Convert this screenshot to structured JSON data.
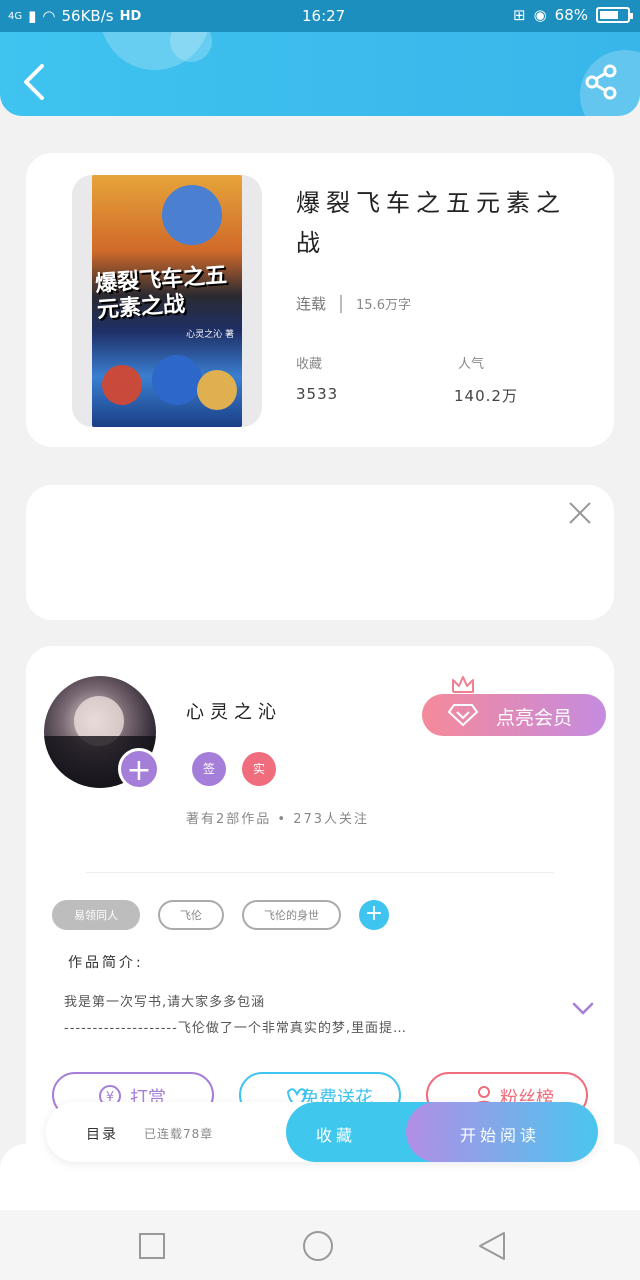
{
  "status_bar": {
    "network": "4G",
    "speed": "56KB/s",
    "hd": "HD",
    "time": "16:27",
    "battery": "68%",
    "battery_level": 0.68
  },
  "header": {
    "back_icon": "chevron-left-icon",
    "share_icon": "share-icon"
  },
  "book": {
    "title": "爆裂飞车之五元素之战",
    "cover_title": "爆裂飞车之五元素之战",
    "cover_author": "心灵之沁 著",
    "status": "连载",
    "word_count": "15.6万字",
    "stats": [
      {
        "label": "收藏",
        "value": "3533"
      },
      {
        "label": "人气",
        "value": "140.2万"
      }
    ]
  },
  "ad": {
    "close_icon": "close-icon"
  },
  "author": {
    "name": "心灵之沁",
    "badges": [
      {
        "text": "签",
        "color": "#a57ed9"
      },
      {
        "text": "实",
        "color": "#f06d7d"
      }
    ],
    "vip_label": "点亮会员",
    "stats": "著有2部作品 • 273人关注"
  },
  "tags": [
    {
      "label": "易领同人",
      "filled": true
    },
    {
      "label": "飞伦",
      "filled": false
    },
    {
      "label": "飞伦的身世",
      "filled": false
    }
  ],
  "intro": {
    "label": "作品简介:",
    "line1": "我是第一次写书,请大家多多包涵",
    "line2": "--------------------飞伦做了一个非常真实的梦,里面提…"
  },
  "actions": [
    {
      "label": "打赏",
      "icon": "yen-icon",
      "color": "#a57ed9"
    },
    {
      "label": "免费送花",
      "icon": "flower-icon",
      "color": "#3fc3ef"
    },
    {
      "label": "粉丝榜",
      "icon": "user-icon",
      "color": "#f06d7d"
    }
  ],
  "bottom_bar": {
    "toc": "目录",
    "chapter_status": "已连载78章",
    "favorite": "收藏",
    "read": "开始阅读"
  },
  "nav": [
    "square-icon",
    "circle-icon",
    "triangle-back-icon"
  ]
}
